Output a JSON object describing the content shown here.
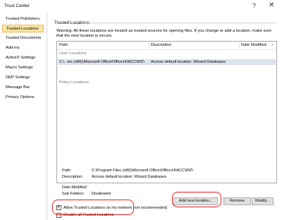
{
  "window": {
    "title": "Trust Center",
    "help": "?",
    "close": "✕"
  },
  "sidebar": {
    "items": [
      {
        "label": "Trusted Publishers"
      },
      {
        "label": "Trusted Locations",
        "selected": true
      },
      {
        "label": "Trusted Documents"
      },
      {
        "label": "Add-ins"
      },
      {
        "label": "ActiveX Settings"
      },
      {
        "label": "Macro Settings"
      },
      {
        "label": "DEP Settings"
      },
      {
        "label": "Message Bar"
      },
      {
        "label": "Privacy Options"
      }
    ]
  },
  "main": {
    "section_title": "Trusted Locations",
    "warning": "Warning: All these locations are treated as trusted sources for opening files.  If you change or add a location, make sure that the new location is secure.",
    "columns": {
      "path": "Path",
      "description": "Description",
      "date_modified": "Date Modified"
    },
    "user_group": "User Locations",
    "policy_group": "Policy Locations",
    "row": {
      "path": "C:\\...les (x86)\\Microsoft Office\\Office14\\ACCWIZ\\",
      "description": "Access default location: Wizard Databases",
      "date_modified": ""
    },
    "details": {
      "path_label": "Path:",
      "path_value": "C:\\Program Files (x86)\\Microsoft Office\\Office14\\ACCWIZ\\",
      "description_label": "Description:",
      "description_value": "Access default location: Wizard Databases",
      "date_modified_label": "Date Modified:",
      "sub_folders_label": "Sub Folders:",
      "sub_folders_value": "Disallowed"
    },
    "buttons": {
      "add": "Add new location...",
      "remove": "Remove",
      "modify": "Modify..."
    },
    "checkboxes": {
      "allow_network": {
        "label": "Allow Trusted Locations on my network (not recommended)",
        "checked": true
      },
      "disable_all": {
        "label": "Disable all Trusted Locations",
        "checked": false
      }
    }
  },
  "colors": {
    "selection": "#fbe5a0",
    "highlight_row": "#dde3ef",
    "annotation": "#e02020"
  }
}
